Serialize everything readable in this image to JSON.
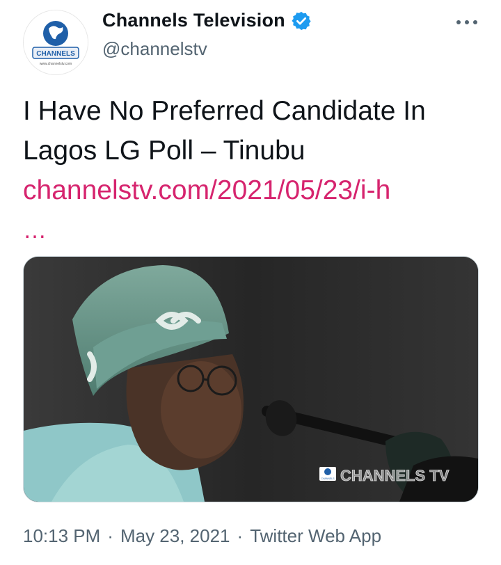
{
  "author": {
    "display_name": "Channels Television",
    "handle": "@channelstv",
    "avatar_text": "CHANNELS",
    "avatar_url_text": "www.channelstv.com",
    "verified": true
  },
  "tweet": {
    "text": "I Have No Preferred Candidate In Lagos LG Poll – Tinubu",
    "link": "channelstv.com/2021/05/23/i-h",
    "ellipsis": "…"
  },
  "media": {
    "watermark": "CHANNELS TV",
    "watermark_logo_text": "CHANNELS"
  },
  "meta": {
    "time": "10:13 PM",
    "date": "May 23, 2021",
    "source": "Twitter Web App",
    "separator": "·"
  },
  "colors": {
    "link": "#d6246e",
    "verified": "#1d9bf0",
    "secondary_text": "#536471"
  },
  "icons": {
    "verified": "verified-badge-icon",
    "more": "more-options-icon"
  }
}
